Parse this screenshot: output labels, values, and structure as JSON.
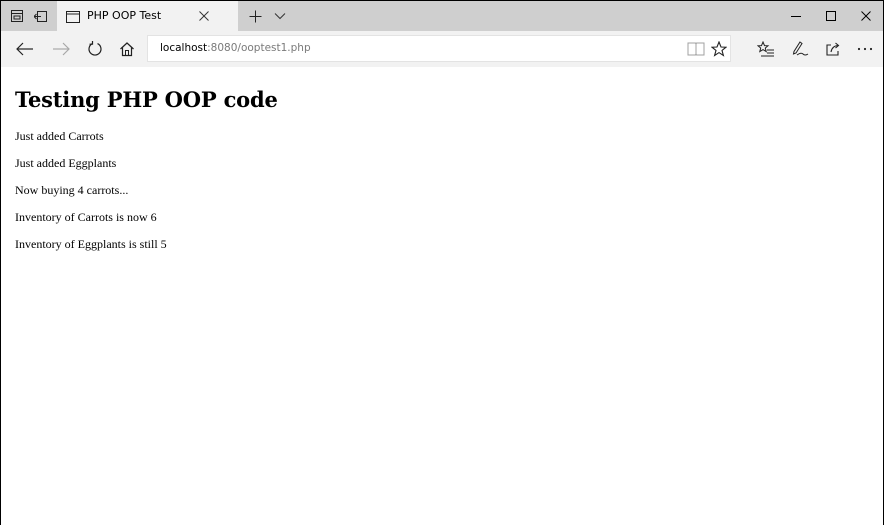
{
  "tab": {
    "title": "PHP OOP Test"
  },
  "address": {
    "host": "localhost",
    "path": ":8080/ooptest1.php"
  },
  "page": {
    "heading": "Testing PHP OOP code",
    "lines": [
      "Just added Carrots",
      "Just added Eggplants",
      "Now buying 4 carrots...",
      "Inventory of Carrots is now 6",
      "Inventory of Eggplants is still 5"
    ]
  },
  "icons": {
    "titlebar": [
      "tab-preview-icon",
      "set-tabs-aside-icon",
      "page-icon",
      "close-tab-icon",
      "new-tab-icon",
      "tab-list-chevron-icon"
    ],
    "window": [
      "minimize-icon",
      "maximize-icon",
      "close-window-icon"
    ],
    "nav": [
      "back-arrow-icon",
      "forward-arrow-icon",
      "refresh-icon",
      "home-icon",
      "reading-view-icon",
      "favorite-star-icon",
      "favorites-hub-icon",
      "web-note-pen-icon",
      "share-icon",
      "more-icon"
    ]
  }
}
